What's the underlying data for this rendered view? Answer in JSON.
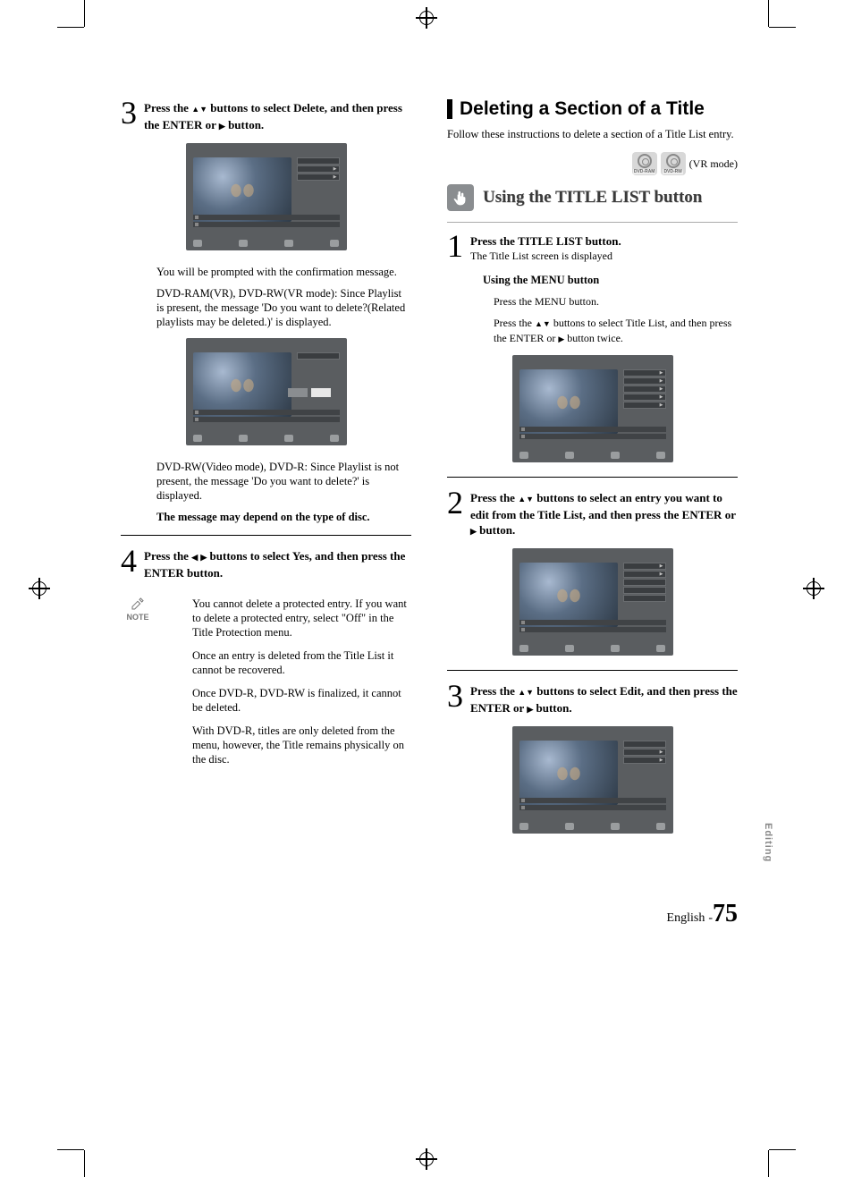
{
  "left": {
    "step3": {
      "num": "3",
      "text_a": "Press the ",
      "text_b": " buttons to select Delete, and then press the ENTER or ",
      "text_c": " button."
    },
    "para1": "You will be prompted with the confirmation message.",
    "para2": "DVD-RAM(VR), DVD-RW(VR mode):  Since Playlist is present, the message 'Do you want to delete?(Related playlists may be deleted.)' is displayed.",
    "para3": "DVD-RW(Video mode), DVD-R:  Since Playlist is not present, the message 'Do you want to delete?' is displayed.",
    "para4": "The message may depend on the type of disc.",
    "step4": {
      "num": "4",
      "text_a": "Press the ",
      "text_b": " buttons to select Yes, and then press the ENTER button."
    },
    "note_label": "NOTE",
    "note1": "You cannot delete a protected entry. If you want to delete a protected entry, select \"Off\" in the Title Protection menu.",
    "note2": "Once an entry is deleted from the Title List it cannot be recovered.",
    "note3": "Once DVD-R, DVD-RW is finalized, it cannot be deleted.",
    "note4": "With DVD-R, titles are only deleted from the menu, however, the Title remains physically on the disc."
  },
  "right": {
    "section_title": "Deleting a Section of a Title",
    "section_intro": "Follow these instructions to delete a section of a Title List entry.",
    "disc1": "DVD-RAM",
    "disc2": "DVD-RW",
    "disc_mode": "(VR mode)",
    "subsection_title": "Using the TITLE LIST button",
    "step1": {
      "num": "1",
      "line1": "Press the TITLE LIST button.",
      "line2": "The Title List screen is displayed",
      "menu_h": "Using the MENU button",
      "menu_1": "Press the MENU button.",
      "menu_2a": "Press the ",
      "menu_2b": " buttons to select Title List, and then press the ENTER or ",
      "menu_2c": " button twice."
    },
    "step2": {
      "num": "2",
      "text_a": "Press the ",
      "text_b": " buttons to select an entry you want to edit from the Title List, and then press the ENTER or ",
      "text_c": " button."
    },
    "step3": {
      "num": "3",
      "text_a": "Press the ",
      "text_b": " buttons to select Edit, and then press the ENTER or ",
      "text_c": " button."
    }
  },
  "side_tab": "Editing",
  "footer": {
    "lang": "English",
    "dash": "-",
    "page": "75"
  }
}
